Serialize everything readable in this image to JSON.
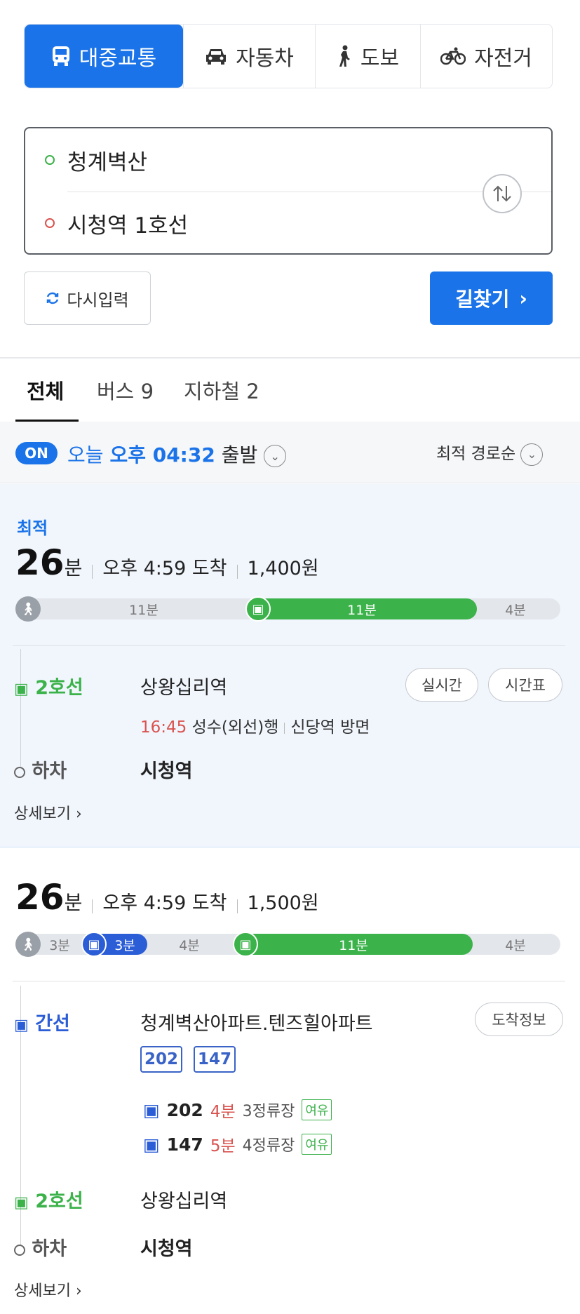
{
  "modes": [
    {
      "label": "대중교통",
      "icon": "bus-icon",
      "active": true
    },
    {
      "label": "자동차",
      "icon": "car-icon"
    },
    {
      "label": "도보",
      "icon": "walk-icon"
    },
    {
      "label": "자전거",
      "icon": "bicycle-icon"
    }
  ],
  "origin": "청계벽산",
  "destination": "시청역 1호선",
  "reset_label": "다시입력",
  "search_label": "길찾기",
  "result_tabs": [
    "전체",
    "버스 9",
    "지하철 2"
  ],
  "filter": {
    "on": "ON",
    "today": "오늘",
    "time": "오후 04:32",
    "depart": "출발",
    "sort": "최적 경로순"
  },
  "colors": {
    "accent": "#1a73e8",
    "subway_line2": "#3bb24a",
    "bus_trunk": "#2b5dd6",
    "delay_red": "#d9534f"
  },
  "route1": {
    "badge": "최적",
    "minutes": "26",
    "min_unit": "분",
    "arrive": "오후 4:59 도착",
    "fare": "1,400원",
    "bar": {
      "walk1": "11분",
      "subway": "11분",
      "walk2": "4분"
    },
    "steps": {
      "line_type": "2호선",
      "station": "상왕십리역",
      "realtime_btn": "실시간",
      "timetable_btn": "시간표",
      "dep_time": "16:45",
      "direction": "성수(외선)행",
      "exit": "신당역 방면",
      "alight_label": "하차",
      "alight_station": "시청역"
    },
    "detail_link": "상세보기"
  },
  "route2": {
    "minutes": "26",
    "min_unit": "분",
    "arrive": "오후 4:59 도착",
    "fare": "1,500원",
    "bar": {
      "walk1": "3분",
      "bus": "3분",
      "walk2": "4분",
      "subway": "11분",
      "walk3": "4분"
    },
    "steps": {
      "bus_type": "간선",
      "bus_stop": "청계벽산아파트.텐즈힐아파트",
      "arrival_btn": "도착정보",
      "bus_tags": [
        "202",
        "147"
      ],
      "buses": [
        {
          "no": "202",
          "eta": "4분",
          "stops": "3정류장",
          "crowd": "여유"
        },
        {
          "no": "147",
          "eta": "5분",
          "stops": "4정류장",
          "crowd": "여유"
        }
      ],
      "line_type": "2호선",
      "station": "상왕십리역",
      "alight_label": "하차",
      "alight_station": "시청역"
    },
    "detail_link": "상세보기"
  }
}
